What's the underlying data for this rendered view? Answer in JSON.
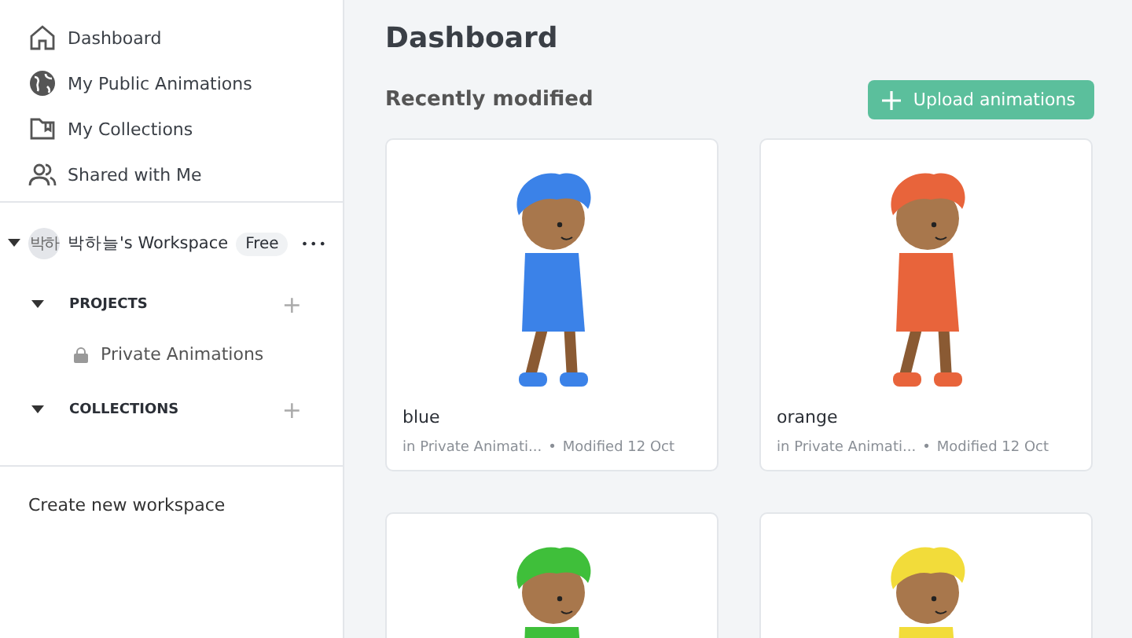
{
  "sidebar": {
    "nav": [
      {
        "label": "Dashboard"
      },
      {
        "label": "My Public Animations"
      },
      {
        "label": "My Collections"
      },
      {
        "label": "Shared with Me"
      }
    ],
    "workspace": {
      "avatar": "박하",
      "name": "박하늘's Workspace",
      "plan": "Free",
      "more": "•••",
      "expanded": true,
      "sections": [
        {
          "label": "PROJECTS",
          "add": "+",
          "expanded": true,
          "items": [
            {
              "label": "Private Animations"
            }
          ]
        },
        {
          "label": "COLLECTIONS",
          "add": "+",
          "expanded": true
        }
      ]
    },
    "create": "Create new workspace"
  },
  "main": {
    "title": "Dashboard",
    "section": "Recently modified",
    "upload": "Upload animations",
    "cards": [
      {
        "title": "blue",
        "location": "in Private Animati...",
        "separator": "•",
        "modified": "Modified 12 Oct",
        "color": "#3b82e8"
      },
      {
        "title": "orange",
        "location": "in Private Animati...",
        "separator": "•",
        "modified": "Modified 12 Oct",
        "color": "#e8643b"
      },
      {
        "color": "#3fbf3a"
      },
      {
        "color": "#f2dc3a"
      }
    ]
  }
}
